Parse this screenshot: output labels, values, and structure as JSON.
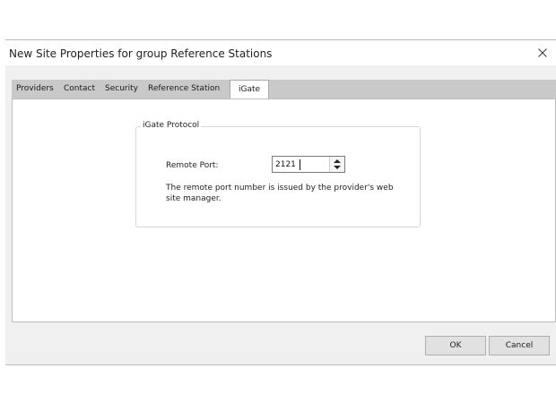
{
  "dialog": {
    "title": "New Site Properties for group Reference Stations",
    "close_icon": "close-icon"
  },
  "tabs": [
    {
      "label": "Providers",
      "active": false
    },
    {
      "label": "Contact",
      "active": false
    },
    {
      "label": "Security",
      "active": false
    },
    {
      "label": "Reference Station",
      "active": false
    },
    {
      "label": "iGate",
      "active": true
    }
  ],
  "group": {
    "legend": "iGate Protocol",
    "remote_port_label": "Remote Port:",
    "remote_port_value": "2121",
    "help_text": "The remote port number is issued by the provider's web site manager."
  },
  "buttons": {
    "ok": "OK",
    "cancel": "Cancel"
  }
}
